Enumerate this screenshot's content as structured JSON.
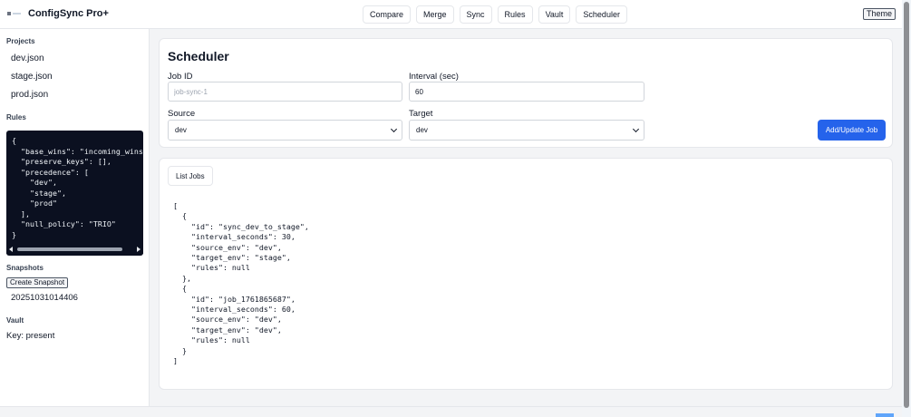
{
  "app": {
    "brand": "ConfigSync Pro+",
    "nav": [
      "Compare",
      "Merge",
      "Sync",
      "Rules",
      "Vault",
      "Scheduler"
    ],
    "theme_label": "Theme"
  },
  "sidebar": {
    "projects_heading": "Projects",
    "projects": [
      "dev.json",
      "stage.json",
      "prod.json"
    ],
    "rules_heading": "Rules",
    "rules_json": "{\n  \"base_wins\": \"incoming_wins\",\n  \"preserve_keys\": [],\n  \"precedence\": [\n    \"dev\",\n    \"stage\",\n    \"prod\"\n  ],\n  \"null_policy\": \"TRIO\"\n}",
    "snapshots_heading": "Snapshots",
    "create_snapshot_label": "Create Snapshot",
    "snapshot_id": "20251031014406",
    "vault_heading": "Vault",
    "vault_status": "Key: present"
  },
  "scheduler": {
    "title": "Scheduler",
    "job_id_label": "Job ID",
    "job_id_placeholder": "job-sync-1",
    "interval_label": "Interval (sec)",
    "interval_value": "60",
    "source_label": "Source",
    "source_value": "dev",
    "target_label": "Target",
    "target_value": "dev",
    "add_button": "Add/Update Job"
  },
  "jobs": {
    "list_button": "List Jobs",
    "output": "[\n  {\n    \"id\": \"sync_dev_to_stage\",\n    \"interval_seconds\": 30,\n    \"source_env\": \"dev\",\n    \"target_env\": \"stage\",\n    \"rules\": null\n  },\n  {\n    \"id\": \"job_1761865687\",\n    \"interval_seconds\": 60,\n    \"source_env\": \"dev\",\n    \"target_env\": \"dev\",\n    \"rules\": null\n  }\n]"
  },
  "colors": {
    "accent": "#2563eb",
    "code_bg": "#0b1020"
  }
}
